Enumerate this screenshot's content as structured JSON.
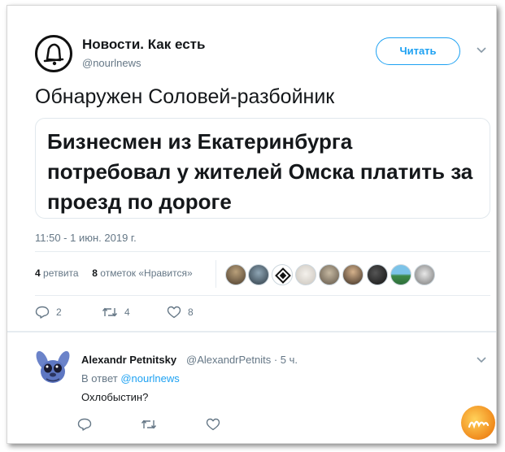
{
  "author": {
    "name": "Новости. Как есть",
    "handle": "@nourlnews",
    "avatar_icon": "bell-icon"
  },
  "follow_button": {
    "label": "Читать"
  },
  "menu_icon": "chevron-down-icon",
  "tweet": {
    "text": "Обнаружен Соловей-разбойник",
    "card_title": "Бизнесмен из Екатеринбурга потребовал у жителей Омска платить за проезд по дороге",
    "timestamp": "11:50 - 1 июн. 2019 г."
  },
  "stats": {
    "retweets_count": "4",
    "retweets_label": "ретвита",
    "likes_count": "8",
    "likes_label": "отметок «Нравится»"
  },
  "likers": [
    {
      "icon": "avatar-1"
    },
    {
      "icon": "avatar-2"
    },
    {
      "icon": "avatar-3"
    },
    {
      "icon": "avatar-4"
    },
    {
      "icon": "avatar-5"
    },
    {
      "icon": "avatar-6"
    },
    {
      "icon": "avatar-7"
    },
    {
      "icon": "avatar-8"
    }
  ],
  "actions": {
    "replies": "2",
    "retweets": "4",
    "likes": "8"
  },
  "reply": {
    "name": "Alexandr Petnitsky",
    "meta": "@AlexandrPetnits · 5 ч.",
    "reply_prefix": "В ответ",
    "reply_handle": "@nourlnews",
    "text": "Охлобыстин?"
  },
  "colors": {
    "accent": "#1da1f2",
    "secondary_text": "#657786",
    "primary_text": "#14171a"
  }
}
